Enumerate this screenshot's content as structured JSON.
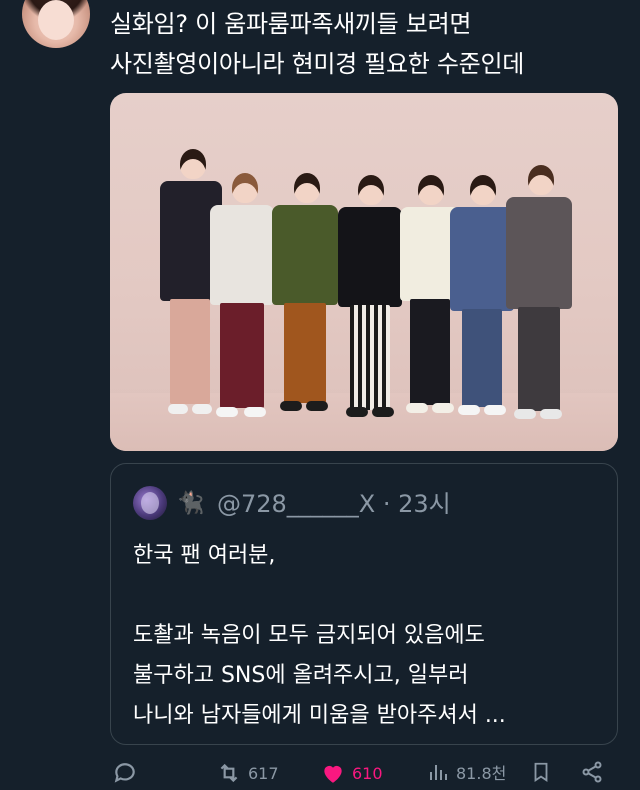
{
  "tweet": {
    "header_cutoff": "· · · · ·",
    "text_lines": [
      "실화임? 이 움파룸파족새끼들 보려면",
      "사진촬영이아니라 현미경 필요한 수준인데"
    ]
  },
  "quote": {
    "handle_line": "@728______X · 23시",
    "body_lines": [
      "한국 팬 여러분,",
      "",
      " 도촬과 녹음이 모두 금지되어 있음에도",
      "불구하고 SNS에 올려주시고, 일부러",
      "나니와 남자들에게 미움을 받아주셔서 ..."
    ]
  },
  "actions": {
    "reply_count": "",
    "retweet_count": "617",
    "like_count": "610",
    "view_count": "81.8천"
  },
  "colors": {
    "background": "#15202b",
    "text": "#ffffff",
    "secondary": "#8b98a5",
    "border": "#38444d",
    "like": "#f91880"
  },
  "icons": {
    "reply": "reply-icon",
    "retweet": "retweet-icon",
    "like": "heart-icon",
    "views": "views-icon",
    "share": "share-icon"
  }
}
